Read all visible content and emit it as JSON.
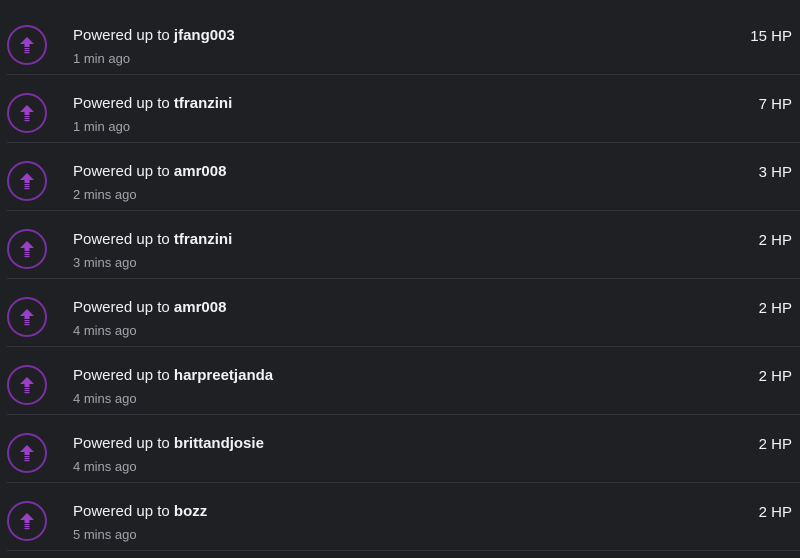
{
  "colors": {
    "background": "#1f2024",
    "accent": "#7a2fa3",
    "divider": "#35363b",
    "text": "#f2f2f4",
    "muted": "#a3a4aa"
  },
  "feed": {
    "items": [
      {
        "prefix": "Powered up to ",
        "user": "jfang003",
        "time": "1 min ago",
        "hp": "15 HP",
        "icon": "power-up-arrow-icon"
      },
      {
        "prefix": "Powered up to ",
        "user": "tfranzini",
        "time": "1 min ago",
        "hp": "7 HP",
        "icon": "power-up-arrow-icon"
      },
      {
        "prefix": "Powered up to ",
        "user": "amr008",
        "time": "2 mins ago",
        "hp": "3 HP",
        "icon": "power-up-arrow-icon"
      },
      {
        "prefix": "Powered up to ",
        "user": "tfranzini",
        "time": "3 mins ago",
        "hp": "2 HP",
        "icon": "power-up-arrow-icon"
      },
      {
        "prefix": "Powered up to ",
        "user": "amr008",
        "time": "4 mins ago",
        "hp": "2 HP",
        "icon": "power-up-arrow-icon"
      },
      {
        "prefix": "Powered up to ",
        "user": "harpreetjanda",
        "time": "4 mins ago",
        "hp": "2 HP",
        "icon": "power-up-arrow-icon"
      },
      {
        "prefix": "Powered up to ",
        "user": "brittandjosie",
        "time": "4 mins ago",
        "hp": "2 HP",
        "icon": "power-up-arrow-icon"
      },
      {
        "prefix": "Powered up to ",
        "user": "bozz",
        "time": "5 mins ago",
        "hp": "2 HP",
        "icon": "power-up-arrow-icon"
      }
    ]
  }
}
